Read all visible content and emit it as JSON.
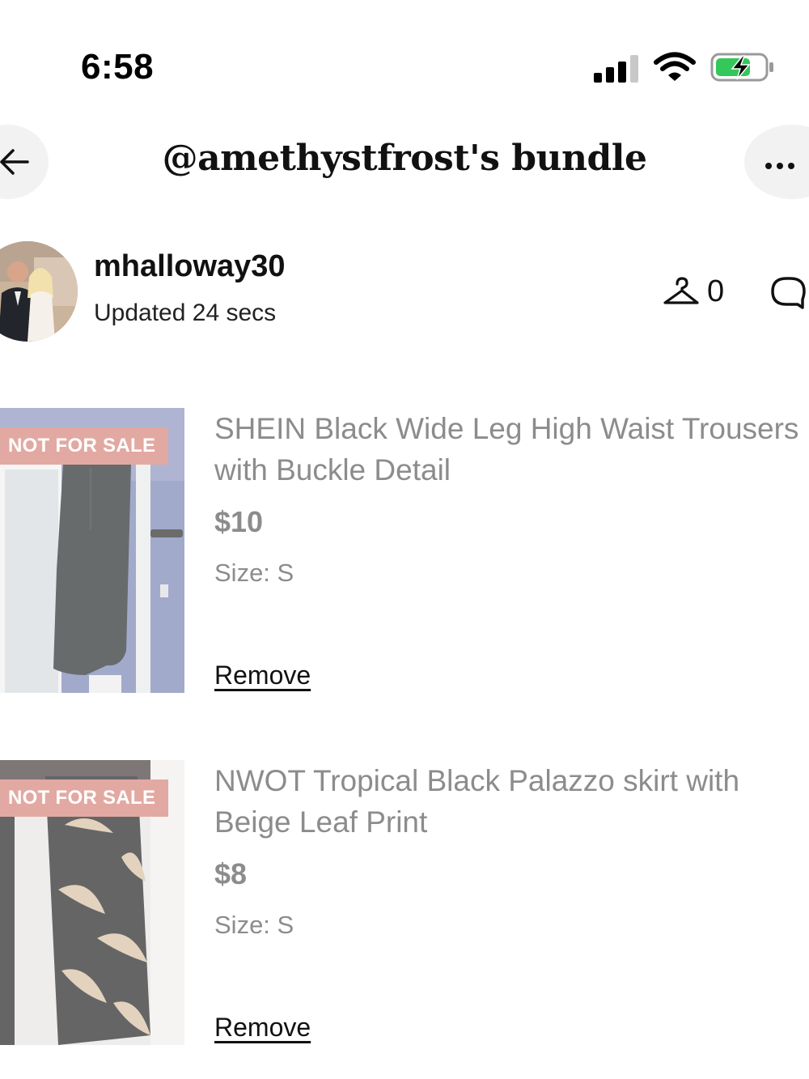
{
  "status_bar": {
    "time": "6:58",
    "icons": [
      "cellular-signal-icon",
      "wifi-icon",
      "battery-charging-icon"
    ]
  },
  "header": {
    "back_icon": "arrow-left-icon",
    "title": "@amethystfrost's bundle",
    "more_icon": "more-horizontal-icon"
  },
  "seller": {
    "username": "mhalloway30",
    "updated": "Updated 24 secs",
    "likes_count": "0",
    "likes_icon": "hanger-icon",
    "comment_icon": "comment-icon"
  },
  "listings": [
    {
      "badge": "NOT FOR SALE",
      "title_line1": "SHEIN Black Wide Leg High Waist Trousers",
      "title_line2": "with Buckle Detail",
      "price": "$10",
      "size": "Size: S",
      "remove_label": "Remove"
    },
    {
      "badge": "NOT FOR SALE",
      "title_line1": "NWOT Tropical Black Palazzo skirt with",
      "title_line2": "Beige Leaf Print",
      "price": "$8",
      "size": "Size: S",
      "remove_label": "Remove"
    }
  ],
  "colors": {
    "badge_bg": "#e2a9a2",
    "muted_text": "#8c8c8c",
    "button_bg": "#f2f2f2"
  }
}
